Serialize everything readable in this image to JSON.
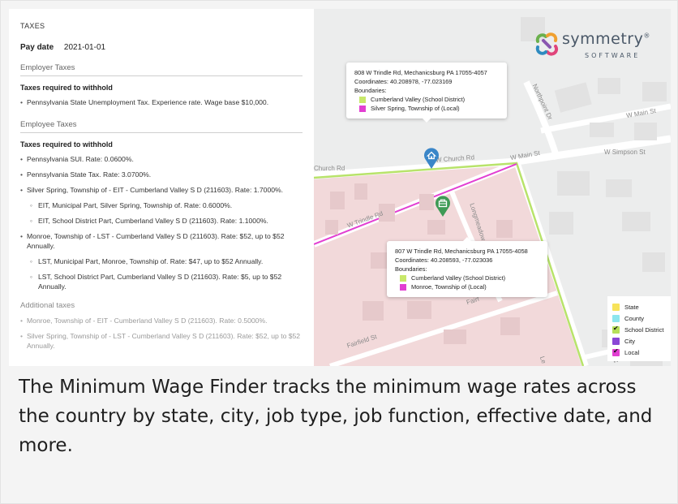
{
  "panel": {
    "title": "TAXES",
    "pay_date_label": "Pay date",
    "pay_date_value": "2021-01-01",
    "employer": {
      "heading": "Employer Taxes",
      "sub_heading": "Taxes required to withhold",
      "items": [
        "Pennsylvania State Unemployment Tax. Experience rate. Wage base $10,000."
      ]
    },
    "employee": {
      "heading": "Employee Taxes",
      "sub_heading": "Taxes required to withhold",
      "items": [
        "Pennsylvania SUI. Rate: 0.0600%.",
        "Pennsylvania State Tax. Rate: 3.0700%.",
        "Silver Spring, Township of - EIT - Cumberland Valley S D (211603). Rate: 1.7000%.",
        "EIT, Municipal Part, Silver Spring, Township of. Rate: 0.6000%.",
        "EIT, School District Part, Cumberland Valley S D (211603). Rate: 1.1000%.",
        "Monroe, Township of - LST - Cumberland Valley S D (211603). Rate: $52, up to $52 Annually.",
        "LST, Municipal Part, Monroe, Township of. Rate: $47, up to $52 Annually.",
        "LST, School District Part, Cumberland Valley S D (211603). Rate: $5, up to $52 Annually."
      ]
    },
    "additional": {
      "heading": "Additional taxes",
      "items": [
        "Monroe, Township of - EIT - Cumberland Valley S D (211603). Rate: 0.5000%.",
        "Silver Spring, Township of - LST - Cumberland Valley S D (211603). Rate: $52, up to $52 Annually."
      ]
    }
  },
  "logo": {
    "name": "symmetry",
    "reg": "®",
    "sub": "SOFTWARE"
  },
  "map": {
    "streets": {
      "w_church_rd_left": "Church Rd",
      "w_church_rd": "W Church Rd",
      "w_main_st": "W Main St",
      "w_main_st_right": "W Main St",
      "w_simpson_st": "W Simpson St",
      "northpoint_dr": "Northpoint Dr",
      "w_trindle_rd": "W Trindle Rd",
      "longmeadow": "Longmeadow",
      "fairfield_st": "Fairfield St",
      "fairfield_2": "Fairf",
      "w_keller_st": "W Keller St",
      "le": "Le"
    },
    "popup_top": {
      "address": "808 W Trindle Rd, Mechanicsburg PA 17055-4057",
      "coords": "Coordinates: 40.208978, -77.023169",
      "boundaries_label": "Boundaries:",
      "boundaries": [
        {
          "name": "Cumberland Valley (School District)",
          "color": "#c8e86a"
        },
        {
          "name": "Silver Spring, Township of (Local)",
          "color": "#e23fd2"
        }
      ]
    },
    "popup_bottom": {
      "address": "807 W Trindle Rd, Mechanicsburg PA 17055-4058",
      "coords": "Coordinates: 40.208593, -77.023036",
      "boundaries_label": "Boundaries:",
      "boundaries": [
        {
          "name": "Cumberland Valley (School District)",
          "color": "#c8e86a"
        },
        {
          "name": "Monroe, Township of (Local)",
          "color": "#e23fd2"
        }
      ]
    },
    "legend": [
      {
        "label": "State",
        "color": "#f7e35a",
        "checked": false
      },
      {
        "label": "County",
        "color": "#8de6ee",
        "checked": false
      },
      {
        "label": "School District",
        "color": "#b6df5a",
        "checked": true
      },
      {
        "label": "City",
        "color": "#8a46d6",
        "checked": false
      },
      {
        "label": "Local",
        "color": "#e23fd2",
        "checked": true
      }
    ],
    "pins": [
      {
        "name": "blue-home-pin",
        "color": "#3a86c8",
        "icon": "home-icon"
      },
      {
        "name": "green-building-pin",
        "color": "#3e9a55",
        "icon": "building-icon"
      }
    ]
  },
  "caption": "The Minimum Wage Finder tracks the minimum wage rates across the country by state, city, job type, job function, effective date, and more."
}
